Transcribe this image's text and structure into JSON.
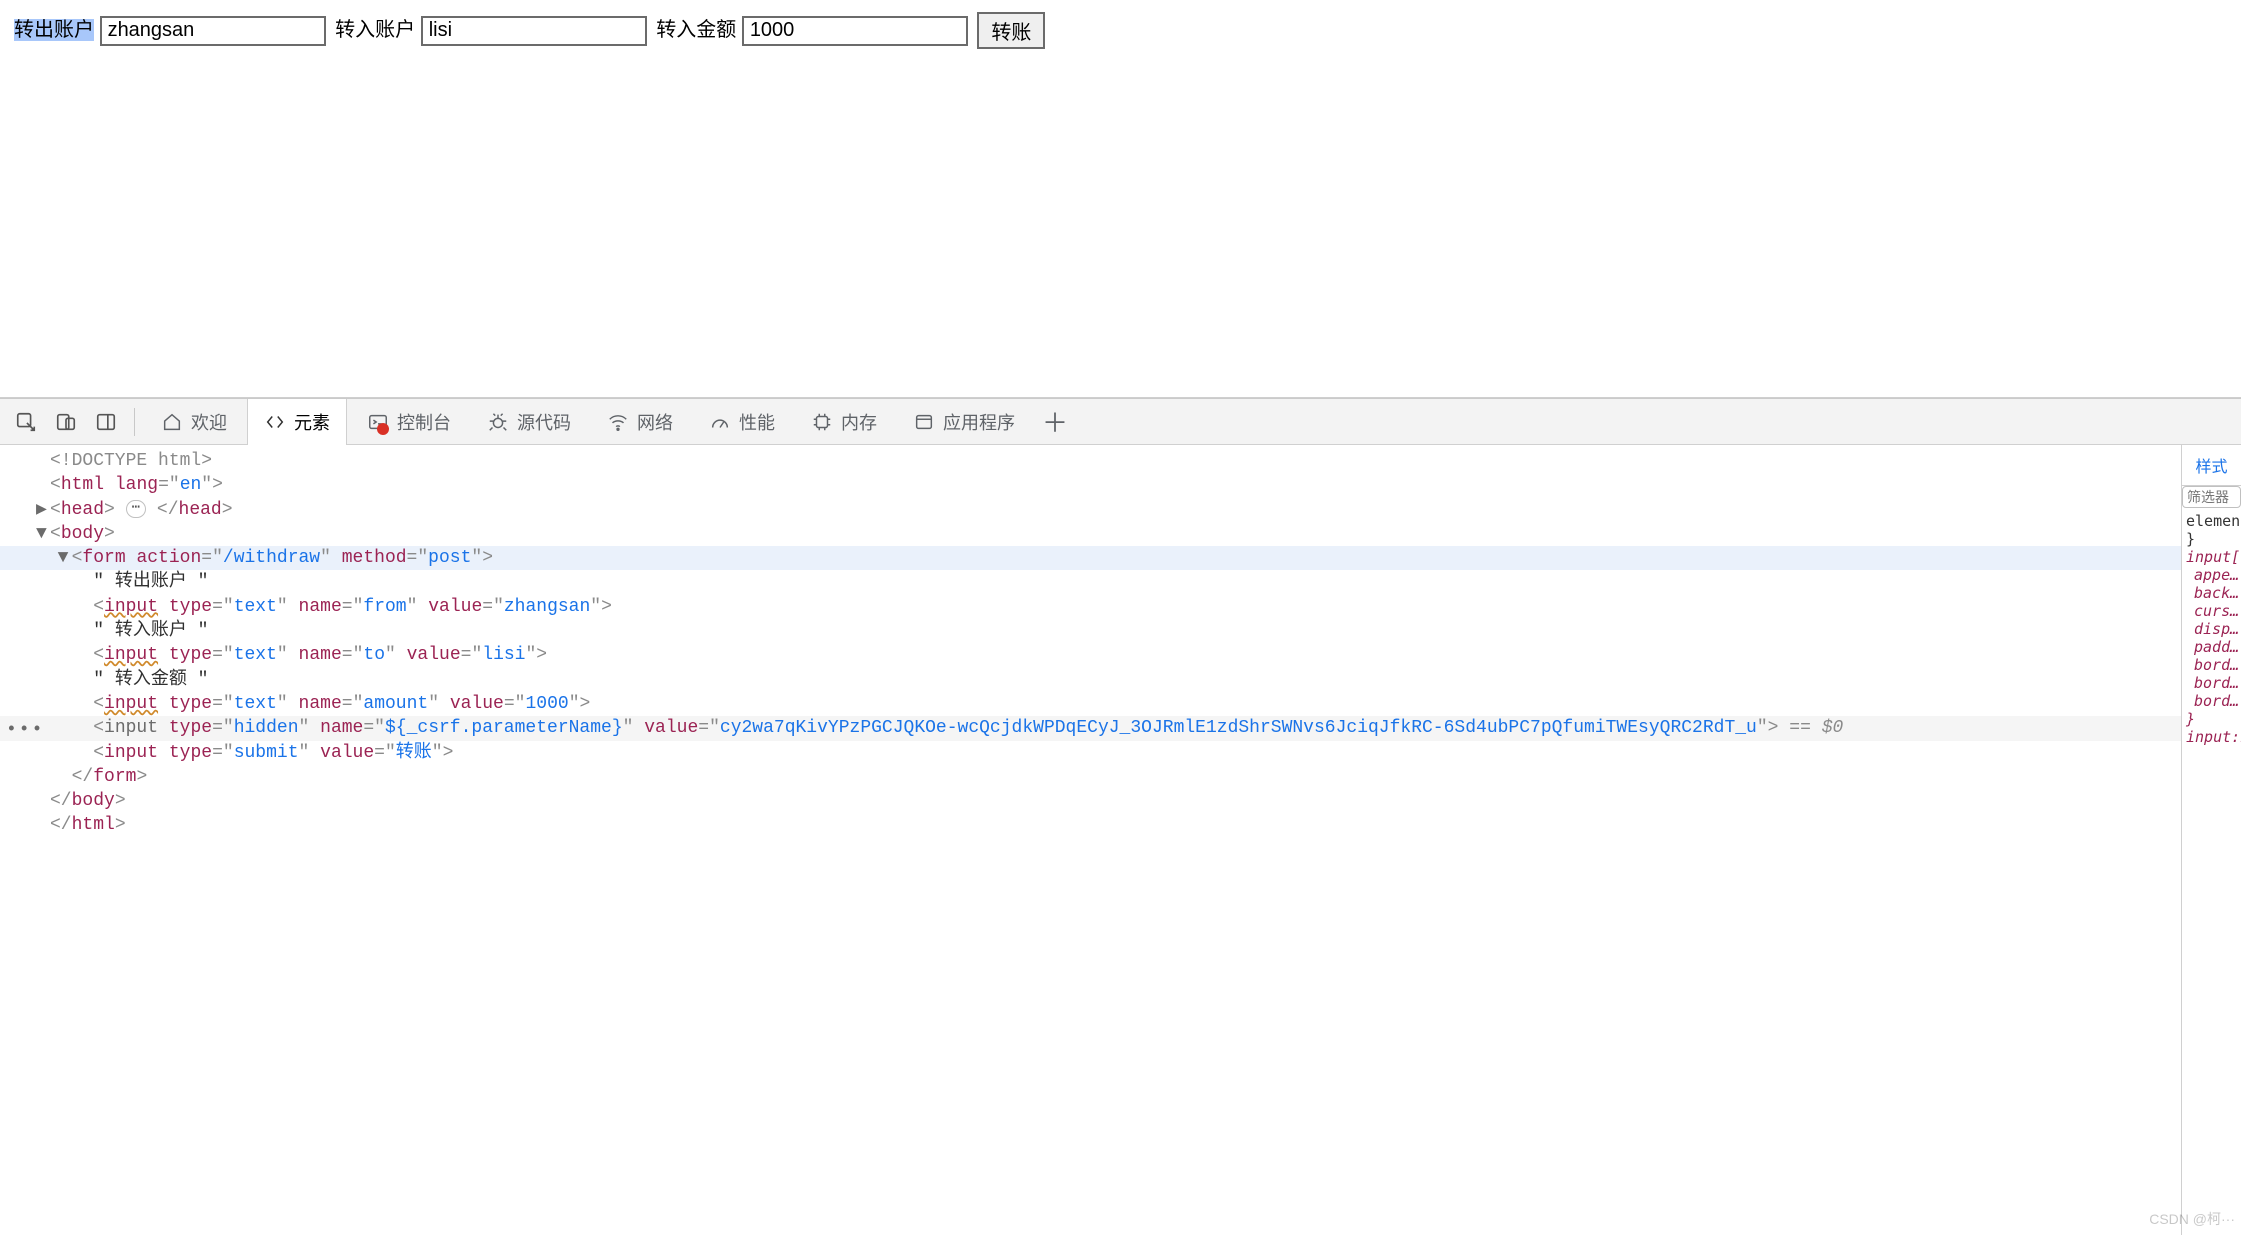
{
  "form": {
    "label_from": "转出账户",
    "value_from": "zhangsan",
    "label_to": "转入账户",
    "value_to": "lisi",
    "label_amount": "转入金额",
    "value_amount": "1000",
    "submit_label": "转账"
  },
  "devtools": {
    "tabs": {
      "welcome": "欢迎",
      "elements": "元素",
      "console": "控制台",
      "sources": "源代码",
      "network": "网络",
      "performance": "性能",
      "memory": "内存",
      "application": "应用程序"
    },
    "styles": {
      "tab_label": "样式",
      "filter_placeholder": "筛选器",
      "rule1_sel": "element.",
      "rule1_close": "}",
      "rule2_sel": "input[t…",
      "props": [
        "appe…",
        "back…",
        "curs…",
        "disp…",
        "padd…",
        "bord…",
        "bord…",
        "bord…"
      ],
      "rule2_close": "}",
      "rule3_sel": "input:n…"
    },
    "dom": {
      "doctype": "<!DOCTYPE html>",
      "html_open": {
        "tag": "html",
        "attrs": [
          [
            "lang",
            "en"
          ]
        ]
      },
      "head_open": {
        "tag": "head"
      },
      "head_close": "</head>",
      "body_open": {
        "tag": "body"
      },
      "form_open": {
        "tag": "form",
        "attrs": [
          [
            "action",
            "/withdraw"
          ],
          [
            "method",
            "post"
          ]
        ]
      },
      "txt_from": "\" 转出账户 \"",
      "input_from": {
        "tag": "input",
        "attrs": [
          [
            "type",
            "text"
          ],
          [
            "name",
            "from"
          ],
          [
            "value",
            "zhangsan"
          ]
        ]
      },
      "txt_to": "\" 转入账户 \"",
      "input_to": {
        "tag": "input",
        "attrs": [
          [
            "type",
            "text"
          ],
          [
            "name",
            "to"
          ],
          [
            "value",
            "lisi"
          ]
        ]
      },
      "txt_amount": "\" 转入金额 \"",
      "input_amount": {
        "tag": "input",
        "attrs": [
          [
            "type",
            "text"
          ],
          [
            "name",
            "amount"
          ],
          [
            "value",
            "1000"
          ]
        ]
      },
      "input_hidden": {
        "tag": "input",
        "grey": true,
        "attrs": [
          [
            "type",
            "hidden"
          ],
          [
            "name",
            "${_csrf.parameterName}"
          ],
          [
            "value",
            "cy2wa7qKivYPzPGCJQKOe-wcQcjdkWPDqECyJ_3OJRmlE1zdShrSWNvs6JciqJfkRC-6Sd4ubPC7pQfumiTWEsyQRC2RdT_u"
          ]
        ]
      },
      "eq0": " == $0",
      "input_submit": {
        "tag": "input",
        "attrs": [
          [
            "type",
            "submit"
          ],
          [
            "value",
            "转账"
          ]
        ]
      },
      "form_close": "</form>",
      "body_close": "</body>",
      "html_close": "</html>"
    }
  },
  "watermark": "CSDN @柯···"
}
